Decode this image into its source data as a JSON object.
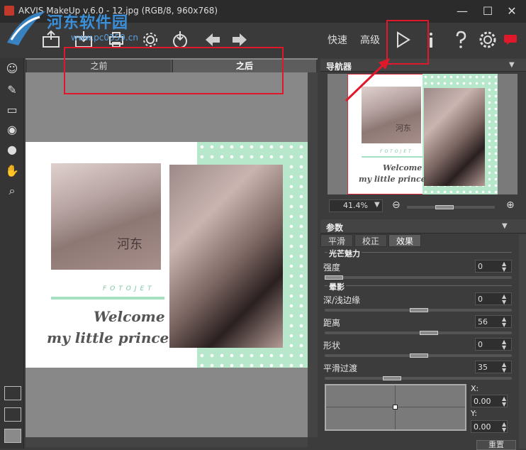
{
  "window": {
    "title": "AKVIS MakeUp v.6.0 - 12.jpg (RGB/8, 960x768)",
    "minimize_label": "—",
    "maximize_label": "☐",
    "close_label": "✕"
  },
  "watermark": {
    "text": "河东软件园",
    "url": "www.pc0359.cn"
  },
  "toolbar": {
    "mode_fast": "快速",
    "mode_advanced": "高级"
  },
  "view_tabs": {
    "before": "之前",
    "after": "之后"
  },
  "image": {
    "cat_label": "河东",
    "brand": "FOTOJET",
    "line1": "Welcome",
    "line2": "my little prince"
  },
  "navigator": {
    "title": "导航器",
    "zoom": "41.4%",
    "cat_label": "河东",
    "brand": "FOTOJET"
  },
  "params": {
    "title": "参数",
    "tabs": [
      "平滑",
      "校正",
      "效果"
    ],
    "active_tab": "效果",
    "sections": {
      "glow": "光芒魅力",
      "vignette": "晕影"
    },
    "fields": {
      "intensity": {
        "label": "强度",
        "value": "0"
      },
      "depth": {
        "label": "深/浅边缘",
        "value": "0"
      },
      "distance": {
        "label": "距离",
        "value": "56"
      },
      "shape": {
        "label": "形状",
        "value": "0"
      },
      "smooth": {
        "label": "平滑过渡",
        "value": "35"
      }
    },
    "x_label": "X:",
    "x_value": "0.00",
    "y_label": "Y:",
    "y_value": "0.00",
    "reset": "重置"
  },
  "colors": {
    "accent_red": "#e0182b",
    "mint": "#b8e8cc"
  }
}
